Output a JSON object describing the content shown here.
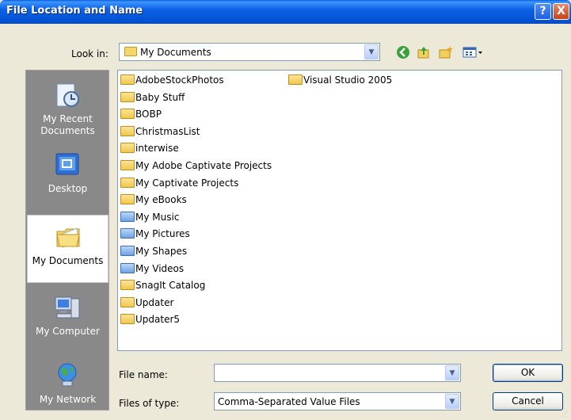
{
  "window": {
    "title": "File Location and Name",
    "help_glyph": "?",
    "close_glyph": "X"
  },
  "lookin": {
    "label": "Look in:",
    "value": "My Documents",
    "arrow": "▼"
  },
  "toolbar": {
    "back_icon": "back-arrow-icon",
    "up_icon": "up-folder-icon",
    "new_folder_icon": "new-folder-icon",
    "views_icon": "views-menu-icon"
  },
  "places": [
    {
      "label": "My Recent Documents",
      "icon": "recent-documents-icon"
    },
    {
      "label": "Desktop",
      "icon": "desktop-icon"
    },
    {
      "label": "My Documents",
      "icon": "my-documents-icon"
    },
    {
      "label": "My Computer",
      "icon": "my-computer-icon"
    },
    {
      "label": "My Network",
      "icon": "my-network-icon"
    }
  ],
  "files": [
    {
      "name": "AdobeStockPhotos",
      "icon": "folder-icon"
    },
    {
      "name": "Baby Stuff",
      "icon": "folder-icon"
    },
    {
      "name": "BOBP",
      "icon": "folder-icon"
    },
    {
      "name": "ChristmasList",
      "icon": "folder-icon"
    },
    {
      "name": "interwise",
      "icon": "folder-icon"
    },
    {
      "name": "My Adobe Captivate Projects",
      "icon": "folder-icon"
    },
    {
      "name": "My Captivate Projects",
      "icon": "folder-icon"
    },
    {
      "name": "My eBooks",
      "icon": "folder-icon"
    },
    {
      "name": "My Music",
      "icon": "music-folder-icon"
    },
    {
      "name": "My Pictures",
      "icon": "pictures-folder-icon"
    },
    {
      "name": "My Shapes",
      "icon": "shapes-folder-icon"
    },
    {
      "name": "My Videos",
      "icon": "videos-folder-icon"
    },
    {
      "name": "SnagIt Catalog",
      "icon": "folder-icon"
    },
    {
      "name": "Updater",
      "icon": "folder-icon"
    },
    {
      "name": "Updater5",
      "icon": "folder-icon"
    },
    {
      "name": "Visual Studio 2005",
      "icon": "folder-icon"
    }
  ],
  "filename": {
    "label": "File name:",
    "value": ""
  },
  "filetype": {
    "label": "Files of type:",
    "value": "Comma-Separated Value Files"
  },
  "buttons": {
    "ok": "OK",
    "cancel": "Cancel"
  }
}
